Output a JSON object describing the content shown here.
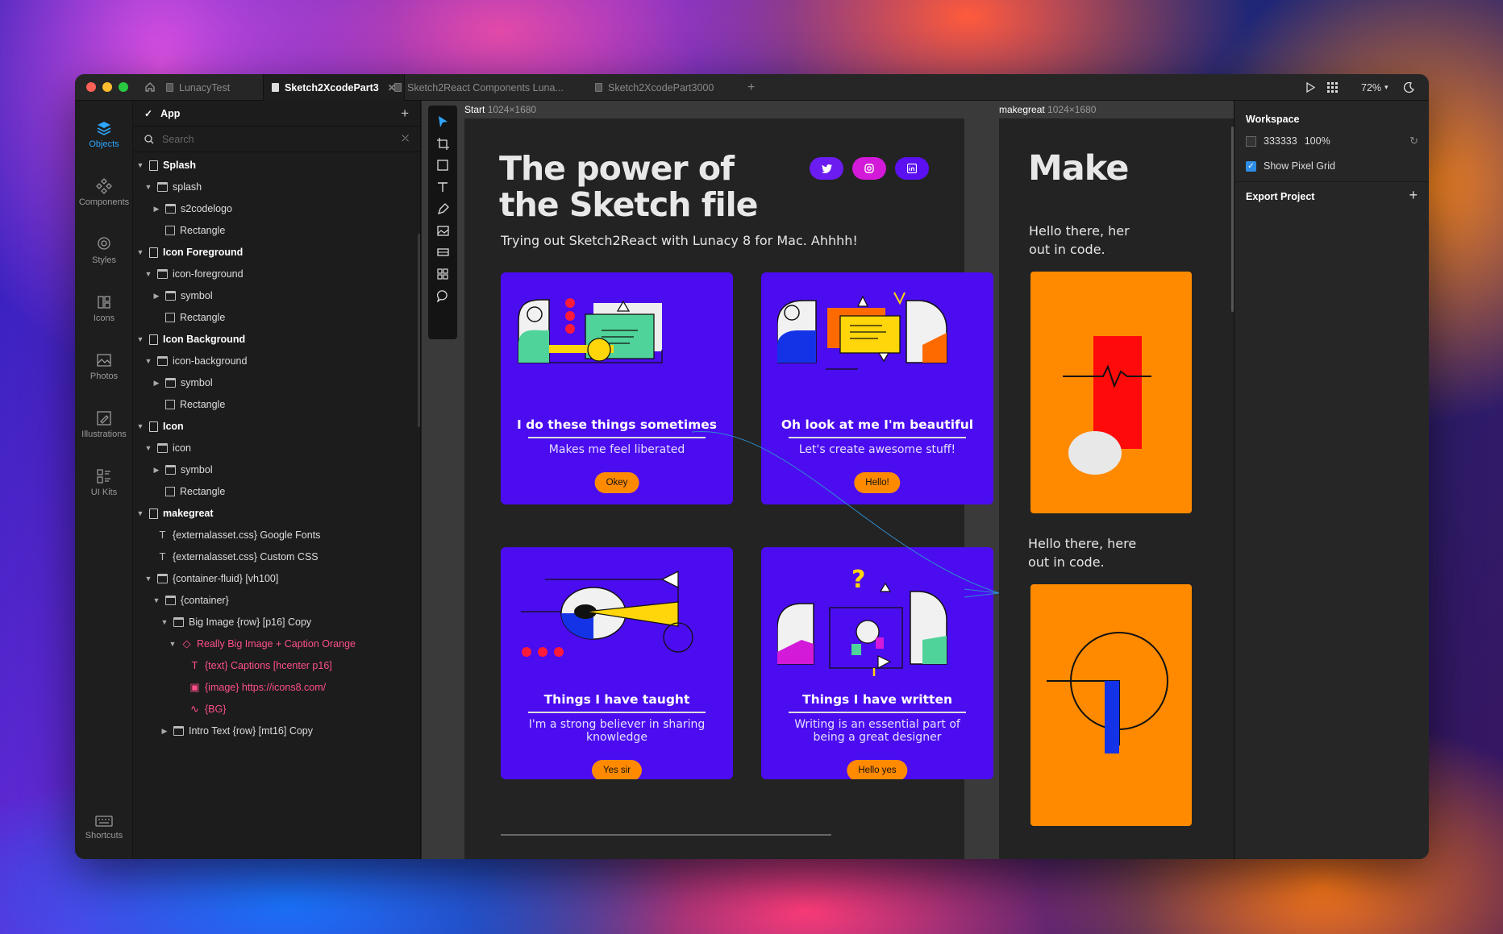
{
  "tabs": [
    {
      "label": "LunacyTest",
      "active": false
    },
    {
      "label": "Sketch2XcodePart3",
      "active": true
    },
    {
      "label": "Sketch2React Components Luna...",
      "active": false
    },
    {
      "label": "Sketch2XcodePart3000",
      "active": false
    }
  ],
  "toolbar": {
    "zoom": "72%"
  },
  "rail": [
    {
      "label": "Objects",
      "icon": "layers-icon",
      "active": true
    },
    {
      "label": "Components",
      "icon": "components-icon"
    },
    {
      "label": "Styles",
      "icon": "styles-icon"
    },
    {
      "label": "Icons",
      "icon": "icons-icon"
    },
    {
      "label": "Photos",
      "icon": "photos-icon"
    },
    {
      "label": "Illustrations",
      "icon": "illustrations-icon"
    },
    {
      "label": "UI Kits",
      "icon": "ui-kits-icon"
    },
    {
      "label": "Shortcuts",
      "icon": "keyboard-icon"
    }
  ],
  "layers": {
    "page_title": "App",
    "search_placeholder": "Search",
    "items": [
      {
        "label": "Splash",
        "type": "page",
        "depth": 0,
        "bold": true,
        "arrow": "down"
      },
      {
        "label": "splash",
        "type": "folder",
        "depth": 1,
        "arrow": "down"
      },
      {
        "label": "s2codelogo",
        "type": "folder",
        "depth": 2,
        "arrow": "right"
      },
      {
        "label": "Rectangle",
        "type": "rect",
        "depth": 2
      },
      {
        "label": "Icon Foreground",
        "type": "page",
        "depth": 0,
        "bold": true,
        "arrow": "down"
      },
      {
        "label": "icon-foreground",
        "type": "folder",
        "depth": 1,
        "arrow": "down"
      },
      {
        "label": "symbol",
        "type": "folder",
        "depth": 2,
        "arrow": "right"
      },
      {
        "label": "Rectangle",
        "type": "rect",
        "depth": 2
      },
      {
        "label": "Icon Background",
        "type": "page",
        "depth": 0,
        "bold": true,
        "arrow": "down"
      },
      {
        "label": "icon-background",
        "type": "folder",
        "depth": 1,
        "arrow": "down"
      },
      {
        "label": "symbol",
        "type": "folder",
        "depth": 2,
        "arrow": "right"
      },
      {
        "label": "Rectangle",
        "type": "rect",
        "depth": 2
      },
      {
        "label": "Icon",
        "type": "page",
        "depth": 0,
        "bold": true,
        "arrow": "down"
      },
      {
        "label": "icon",
        "type": "folder",
        "depth": 1,
        "arrow": "down"
      },
      {
        "label": "symbol",
        "type": "folder",
        "depth": 2,
        "arrow": "right"
      },
      {
        "label": "Rectangle",
        "type": "rect",
        "depth": 2
      },
      {
        "label": "makegreat",
        "type": "page",
        "depth": 0,
        "bold": true,
        "arrow": "down"
      },
      {
        "label": "{externalasset.css} Google Fonts",
        "type": "text",
        "depth": 1
      },
      {
        "label": "{externalasset.css} Custom CSS",
        "type": "text",
        "depth": 1
      },
      {
        "label": "{container-fluid} [vh100]",
        "type": "folder",
        "depth": 1,
        "arrow": "down"
      },
      {
        "label": "{container}",
        "type": "folder",
        "depth": 2,
        "arrow": "down"
      },
      {
        "label": "Big Image {row} [p16] Copy",
        "type": "folder",
        "depth": 3,
        "arrow": "down"
      },
      {
        "label": "Really Big Image + Caption Orange",
        "type": "symbol",
        "depth": 4,
        "arrow": "down",
        "pink": true
      },
      {
        "label": "{text} Captions [hcenter p16]",
        "type": "text",
        "depth": 5,
        "pink": true
      },
      {
        "label": "{image} https://icons8.com/",
        "type": "image",
        "depth": 5,
        "pink": true
      },
      {
        "label": "{BG}",
        "type": "vector",
        "depth": 5,
        "pink": true
      },
      {
        "label": "Intro Text {row} [mt16] Copy",
        "type": "folder",
        "depth": 3,
        "arrow": "right"
      }
    ]
  },
  "canvas": {
    "artboard1": {
      "name": "Start",
      "size": "1024×1680"
    },
    "artboard2": {
      "name": "makegreat",
      "size": "1024×1680"
    },
    "hero_line1": "The power of",
    "hero_line2": "the Sketch file",
    "subtitle": "Trying out Sketch2React with Lunacy 8 for Mac. Ahhhh!",
    "social": [
      {
        "icon": "twitter-icon",
        "color": "#6b1cf0"
      },
      {
        "icon": "instagram-icon",
        "color": "#d21ad8"
      },
      {
        "icon": "linkedin-icon",
        "color": "#5a10f0"
      }
    ],
    "cards": [
      {
        "title": "I do these things sometimes",
        "desc": "Makes me feel liberated",
        "button": "Okey"
      },
      {
        "title": "Oh look at me I'm beautiful",
        "desc": "Let's create awesome stuff!",
        "button": "Hello!"
      },
      {
        "title": "Things I have taught",
        "desc": "I'm a strong believer in sharing knowledge",
        "button": "Yes sir"
      },
      {
        "title": "Things I have written",
        "desc": "Writing is an essential part of being a great designer",
        "button": "Hello yes"
      }
    ],
    "right_heading": "Make",
    "right_para1_l1": "Hello there, her",
    "right_para1_l2": "out in code.",
    "right_para2_l1": "Hello there, here",
    "right_para2_l2": "out in code."
  },
  "inspector": {
    "workspace_title": "Workspace",
    "color_hex": "333333",
    "opacity": "100%",
    "show_pixel_grid": "Show Pixel Grid",
    "pixel_grid_checked": true,
    "export_title": "Export Project"
  },
  "colors": {
    "accent": "#2ea5ff",
    "card_bg": "#4b0cf0",
    "button": "#ff8a00",
    "pink_layer": "#ff4f8b"
  }
}
